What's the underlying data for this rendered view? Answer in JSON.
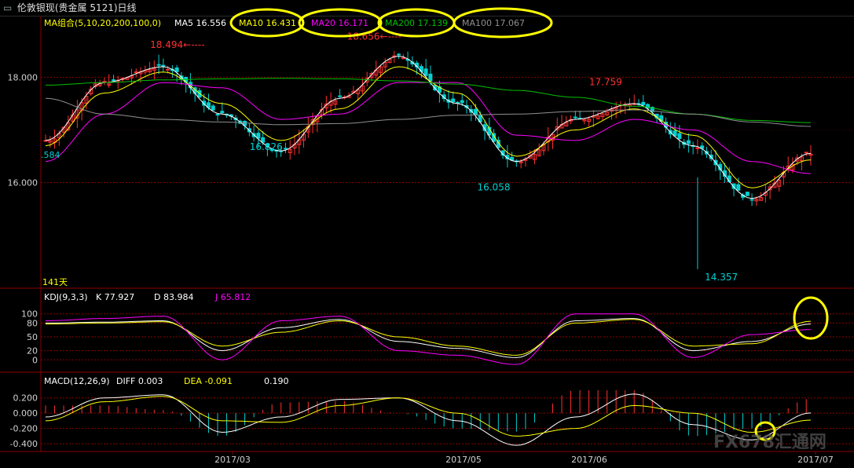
{
  "window": {
    "title": "伦敦银现(贵金属 5121)日线"
  },
  "colors": {
    "up": "#ff3030",
    "down": "#00d0d0",
    "ma5": "#ffffff",
    "ma10": "#ffff00",
    "ma20": "#ff00ff",
    "ma200": "#00c000",
    "ma100": "#909090",
    "grid": "#8b0000",
    "annot_high": "#ff3030",
    "annot_low": "#00d0d0",
    "highlight": "#ffff00"
  },
  "main_panel": {
    "legend_prefix": "MA组合(5,10,20,200,100,0)",
    "legend": [
      {
        "label": "MA5 16.556",
        "color": "#ffffff"
      },
      {
        "label": "MA10 16.431",
        "color": "#ffff00"
      },
      {
        "label": "MA20 16.171",
        "color": "#ff00ff"
      },
      {
        "label": "MA200 17.139",
        "color": "#00c000"
      },
      {
        "label": "MA100 17.067",
        "color": "#909090"
      }
    ],
    "y_ticks": [
      "18.000",
      "16.000"
    ],
    "left_value": ".584",
    "bottom_left_label": "141天",
    "annotations": {
      "h1": "18.494",
      "h2": "18.656",
      "h3": "17.759",
      "l1": "16.826",
      "l2": "16.058",
      "l3": "14.357"
    }
  },
  "kdj_panel": {
    "legend": [
      {
        "label": "KDJ(9,3,3)",
        "color": "#ffffff"
      },
      {
        "label": "K  77.927",
        "color": "#ffffff"
      },
      {
        "label": "D  83.984",
        "color": "#ffffff"
      },
      {
        "label": "J  65.812",
        "color": "#ff00ff"
      }
    ],
    "y_ticks": [
      "100",
      "80",
      "50",
      "20",
      "0"
    ]
  },
  "macd_panel": {
    "legend": [
      {
        "label": "MACD(12,26,9)",
        "color": "#ffffff"
      },
      {
        "label": "DIFF  0.003",
        "color": "#ffffff"
      },
      {
        "label": "DEA  -0.091",
        "color": "#ffff00"
      },
      {
        "label": "0.190",
        "color": "#ffffff"
      }
    ],
    "y_ticks": [
      "0.200",
      "0.000",
      "-0.200",
      "-0.400"
    ]
  },
  "x_axis": {
    "labels": [
      "2017/03",
      "2017/05",
      "2017/06",
      "2017/07"
    ]
  },
  "watermark": "FX678汇通网",
  "chart_data": [
    {
      "type": "line",
      "title": "伦敦银现(贵金属 5121)日线",
      "panel": "price",
      "ylim": [
        14.1,
        18.9
      ],
      "x": [
        "2017/03",
        "2017/05",
        "2017/06",
        "2017/07"
      ],
      "series": [
        {
          "name": "MA5",
          "values": [
            16.8,
            17.9,
            18.2,
            17.3,
            16.6,
            17.6,
            18.4,
            17.5,
            16.4,
            17.2,
            17.5,
            16.7,
            15.7,
            16.556
          ]
        },
        {
          "name": "MA10",
          "values": [
            16.7,
            17.7,
            18.1,
            17.5,
            16.8,
            17.4,
            18.2,
            17.7,
            16.5,
            17.0,
            17.4,
            16.9,
            15.9,
            16.431
          ]
        },
        {
          "name": "MA20",
          "values": [
            16.4,
            17.3,
            17.9,
            17.8,
            17.2,
            17.3,
            17.9,
            17.9,
            16.9,
            16.8,
            17.2,
            17.0,
            16.4,
            16.171
          ]
        },
        {
          "name": "MA200",
          "values": [
            17.85,
            17.9,
            17.95,
            17.97,
            17.98,
            17.97,
            17.93,
            17.87,
            17.75,
            17.62,
            17.45,
            17.3,
            17.18,
            17.139
          ]
        },
        {
          "name": "MA100",
          "values": [
            17.6,
            17.3,
            17.2,
            17.15,
            17.1,
            17.12,
            17.2,
            17.28,
            17.3,
            17.35,
            17.38,
            17.3,
            17.15,
            17.067
          ]
        }
      ],
      "annotations": [
        {
          "label": "18.494",
          "value": 18.494
        },
        {
          "label": "18.656",
          "value": 18.656
        },
        {
          "label": "17.759",
          "value": 17.759
        },
        {
          "label": "16.826",
          "value": 16.826
        },
        {
          "label": "16.058",
          "value": 16.058
        },
        {
          "label": "14.357",
          "value": 14.357
        }
      ]
    },
    {
      "type": "line",
      "title": "KDJ(9,3,3)",
      "panel": "kdj",
      "ylim": [
        -20,
        120
      ],
      "series": [
        {
          "name": "K",
          "values": [
            80,
            82,
            85,
            20,
            70,
            88,
            40,
            25,
            5,
            85,
            90,
            20,
            40,
            77.927
          ]
        },
        {
          "name": "D",
          "values": [
            78,
            80,
            83,
            30,
            60,
            85,
            50,
            30,
            10,
            80,
            88,
            30,
            35,
            83.984
          ]
        },
        {
          "name": "J",
          "values": [
            85,
            90,
            95,
            0,
            85,
            95,
            20,
            10,
            -10,
            100,
            100,
            5,
            55,
            65.812
          ]
        }
      ]
    },
    {
      "type": "bar",
      "title": "MACD(12,26,9)",
      "panel": "macd",
      "ylim": [
        -0.45,
        0.32
      ],
      "series": [
        {
          "name": "DIFF",
          "values": [
            -0.05,
            0.2,
            0.24,
            -0.25,
            -0.05,
            0.18,
            0.2,
            -0.1,
            -0.42,
            -0.05,
            0.25,
            -0.15,
            -0.35,
            0.003
          ]
        },
        {
          "name": "DEA",
          "values": [
            -0.1,
            0.15,
            0.22,
            -0.1,
            -0.12,
            0.1,
            0.2,
            0.0,
            -0.3,
            -0.2,
            0.1,
            0.0,
            -0.25,
            -0.091
          ]
        },
        {
          "name": "MACD",
          "values": [
            0.1,
            0.1,
            0.04,
            -0.3,
            0.14,
            0.16,
            0.0,
            -0.2,
            -0.24,
            0.3,
            0.3,
            -0.3,
            -0.2,
            0.19
          ]
        }
      ]
    }
  ]
}
